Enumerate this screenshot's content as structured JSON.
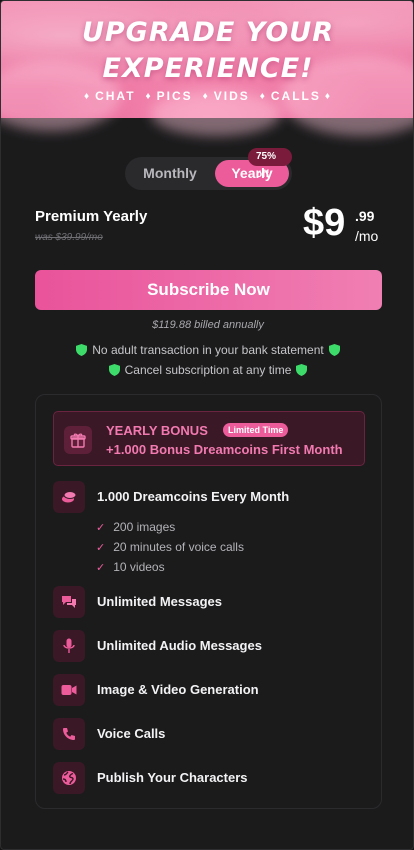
{
  "banner": {
    "title_line1": "UPGRADE YOUR",
    "title_line2": "EXPERIENCE!",
    "features": [
      "CHAT",
      "PICS",
      "VIDS",
      "CALLS"
    ]
  },
  "toggle": {
    "monthly": "Monthly",
    "yearly": "Yearly",
    "badge": "75% off",
    "selected": "Yearly"
  },
  "plan": {
    "name": "Premium Yearly",
    "was": "was $39.99/mo",
    "price_main": "$9",
    "price_cents": ".99",
    "per": "/mo"
  },
  "cta": {
    "subscribe": "Subscribe Now"
  },
  "billing": {
    "billed": "$119.88 billed annually",
    "assurance1": "No adult transaction in your bank statement",
    "assurance2": "Cancel subscription at any time"
  },
  "bonus": {
    "title": "YEARLY BONUS",
    "tag": "Limited Time",
    "desc": "+1.000 Bonus Dreamcoins First Month",
    "icon": "gift-icon"
  },
  "features": [
    {
      "label": "1.000 Dreamcoins Every Month",
      "icon": "coins-icon"
    },
    {
      "label": "Unlimited Messages",
      "icon": "chat-bubbles-icon"
    },
    {
      "label": "Unlimited Audio Messages",
      "icon": "microphone-icon"
    },
    {
      "label": "Image & Video Generation",
      "icon": "video-camera-icon"
    },
    {
      "label": "Voice Calls",
      "icon": "phone-icon"
    },
    {
      "label": "Publish Your Characters",
      "icon": "globe-icon"
    }
  ],
  "dreamcoin_details": [
    "200 images",
    "20 minutes of voice calls",
    "10 videos"
  ],
  "colors": {
    "accent": "#ec5b9a",
    "accent_text": "#f27ab0",
    "background": "#1b1b1c",
    "shield": "#3ddc6a"
  }
}
